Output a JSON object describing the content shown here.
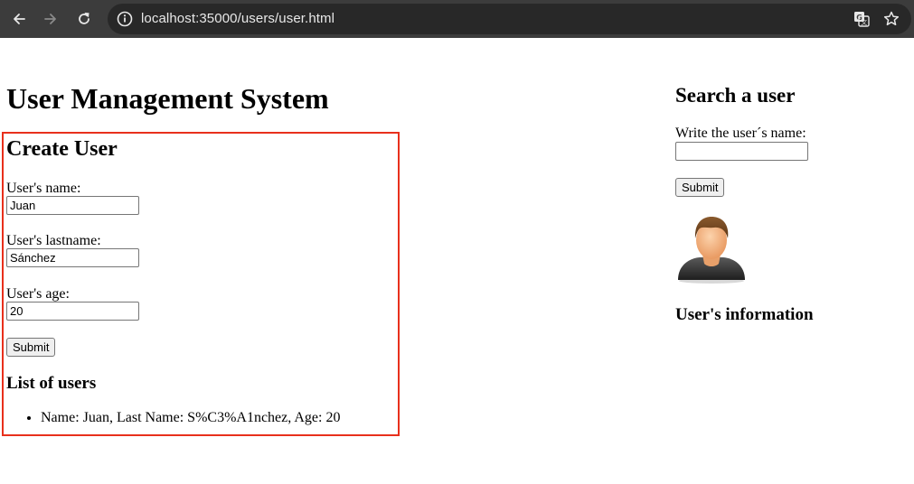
{
  "browser": {
    "url": "localhost:35000/users/user.html",
    "icons": [
      "back-arrow-icon",
      "forward-arrow-icon",
      "reload-icon",
      "site-info-icon",
      "translate-icon",
      "bookmark-star-icon"
    ]
  },
  "page": {
    "title": "User Management System"
  },
  "create_user": {
    "heading": "Create User",
    "name_label": "User's name:",
    "name_value": "Juan",
    "lastname_label": "User's lastname:",
    "lastname_value": "Sánchez",
    "age_label": "User's age:",
    "age_value": "20",
    "submit_label": "Submit",
    "highlight_color": "#e8301c"
  },
  "users_list": {
    "heading": "List of users",
    "items": [
      "Name: Juan, Last Name: S%C3%A1nchez, Age: 20"
    ]
  },
  "search_user": {
    "heading": "Search a user",
    "name_label": "Write the user´s name:",
    "name_value": "",
    "submit_label": "Submit",
    "avatar_icon": "user-avatar-icon",
    "info_heading": "User's information"
  }
}
